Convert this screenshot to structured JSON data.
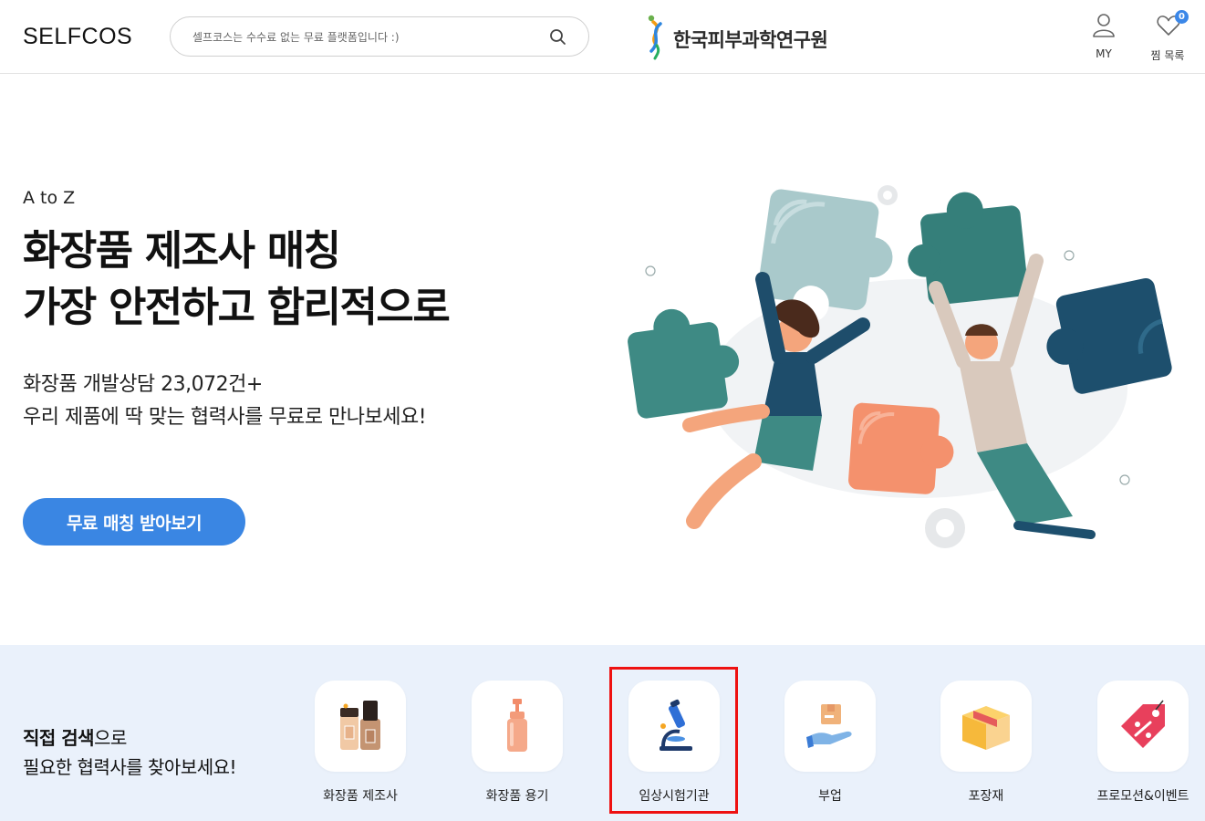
{
  "header": {
    "logo": "SELFCOS",
    "search_placeholder": "셀프코스는 수수료 없는 무료 플랫폼입니다 :)",
    "partner_name": "한국피부과학연구원",
    "my_label": "MY",
    "wishlist_label": "찜 목록",
    "wishlist_count": "0"
  },
  "hero": {
    "eyebrow": "A to Z",
    "headline_line1": "화장품 제조사 매칭",
    "headline_line2": "가장 안전하고 합리적으로",
    "sub_line1": "화장품 개발상담 23,072건+",
    "sub_line2": "우리 제품에 딱 맞는 협력사를 무료로 만나보세요!",
    "cta": "무료 매칭 받아보기"
  },
  "categories_section": {
    "title_bold": "직접 검색",
    "title_rest": "으로",
    "subtitle": "필요한 협력사를 찾아보세요!",
    "items": [
      {
        "label": "화장품 제조사",
        "icon": "foundation-bottles-icon"
      },
      {
        "label": "화장품 용기",
        "icon": "pump-bottle-icon"
      },
      {
        "label": "임상시험기관",
        "icon": "microscope-icon"
      },
      {
        "label": "부업",
        "icon": "hand-box-icon"
      },
      {
        "label": "포장재",
        "icon": "package-box-icon"
      },
      {
        "label": "프로모션&이벤트",
        "icon": "discount-tag-icon"
      }
    ]
  },
  "colors": {
    "accent": "#3a86e3",
    "band_bg": "#eaf1fb",
    "highlight": "#e11111"
  }
}
